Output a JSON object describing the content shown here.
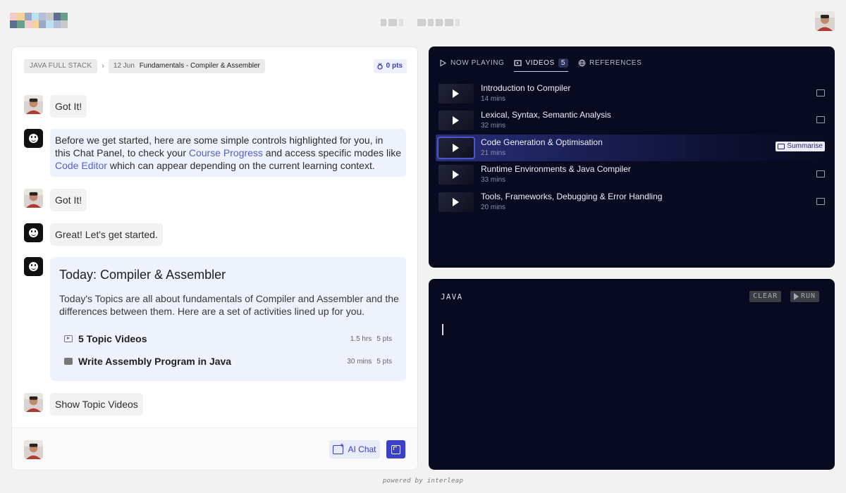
{
  "header": {
    "logo_icon": "brand-logo-icon",
    "logo_colors": [
      "#f7c9c9",
      "#b9e2ef",
      "#5f6e8f",
      "#f4d29a",
      "#b6bfd9",
      "#6aa08a",
      "#9aa8c8",
      "#c9c9c9"
    ],
    "avatar_icon": "user-avatar-icon"
  },
  "chat": {
    "breadcrumb": {
      "track": "JAVA FULL STACK",
      "separator": "›",
      "date": "12 Jun",
      "lesson": "Fundamentals - Compiler & Assembler"
    },
    "points": "0 pts",
    "messages": [
      {
        "sender": "user",
        "text": "Got It!"
      },
      {
        "sender": "bot",
        "text_before": "Before we get started, here are some simple controls highlighted for you, in this Chat Panel, to check your ",
        "link1": "Course Progress",
        "text_mid": " and access specific modes like ",
        "link2": "Code Editor",
        "text_after": " which can appear depending on the current learning context."
      },
      {
        "sender": "user",
        "text": "Got It!"
      },
      {
        "sender": "bot",
        "text": "Great! Let's get started."
      }
    ],
    "today_card": {
      "title": "Today: Compiler & Assembler",
      "description": "Today's Topics are all about fundamentals of Compiler and Assembler and the differences between them. Here are a set of activities lined up for you.",
      "activities": [
        {
          "icon": "video-icon",
          "label": "5 Topic Videos",
          "duration": "1.5 hrs",
          "points": "5 pts"
        },
        {
          "icon": "code-icon",
          "label": "Write Assembly Program in Java",
          "duration": "30 mins",
          "points": "5 pts"
        }
      ]
    },
    "last_user_message": "Show Topic Videos",
    "footer": {
      "ai_chat_label": "AI Chat"
    }
  },
  "videos": {
    "tabs": [
      {
        "label": "NOW PLAYING",
        "icon": "play-outline-icon"
      },
      {
        "label": "VIDEOS",
        "icon": "video-list-icon",
        "count": "5",
        "active": true
      },
      {
        "label": "REFERENCES",
        "icon": "globe-icon"
      }
    ],
    "items": [
      {
        "title": "Introduction to Compiler",
        "duration": "14 mins"
      },
      {
        "title": "Lexical, Syntax, Semantic Analysis",
        "duration": "32 mins"
      },
      {
        "title": "Code Generation & Optimisation",
        "duration": "21 mins",
        "active": true,
        "action": "Summarise"
      },
      {
        "title": "Runtime Environments & Java Compiler",
        "duration": "33 mins"
      },
      {
        "title": "Tools, Frameworks, Debugging & Error Handling",
        "duration": "20 mins"
      }
    ]
  },
  "editor": {
    "language": "JAVA",
    "clear_label": "CLEAR",
    "run_label": "RUN"
  },
  "footer_note": "powered by interleap",
  "colors": {
    "accent": "#3a40c8",
    "panel_dark": "#080b20",
    "link": "#5561c6"
  }
}
